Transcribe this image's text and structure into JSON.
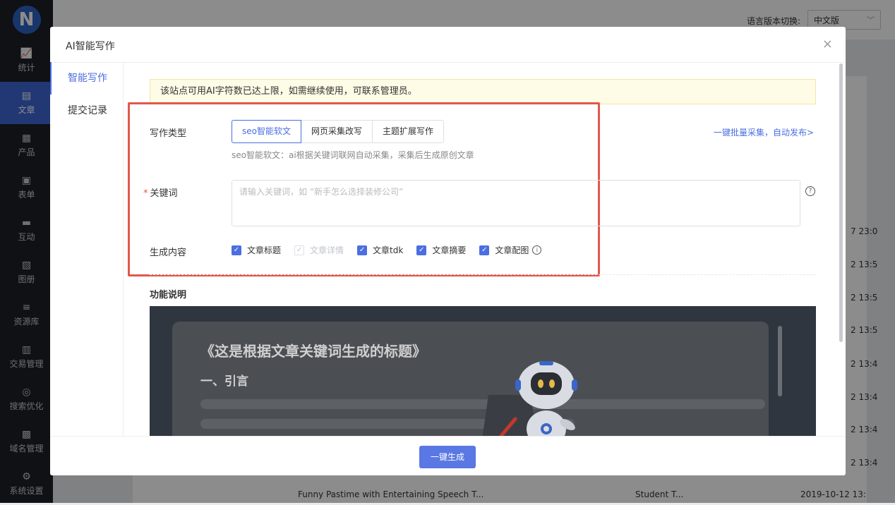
{
  "sidebar": {
    "logo": "N",
    "items": [
      {
        "label": "统计",
        "icon": "chart-icon",
        "glyph": "📈"
      },
      {
        "label": "文章",
        "icon": "article-icon",
        "glyph": "▤",
        "active": true
      },
      {
        "label": "产品",
        "icon": "product-icon",
        "glyph": "▦"
      },
      {
        "label": "表单",
        "icon": "form-icon",
        "glyph": "▣"
      },
      {
        "label": "互动",
        "icon": "chat-icon",
        "glyph": "▬"
      },
      {
        "label": "图册",
        "icon": "album-icon",
        "glyph": "▧"
      },
      {
        "label": "资源库",
        "icon": "database-icon",
        "glyph": "≡"
      },
      {
        "label": "交易管理",
        "icon": "bag-icon",
        "glyph": "▥"
      },
      {
        "label": "搜索优化",
        "icon": "target-icon",
        "glyph": "◎"
      },
      {
        "label": "域名管理",
        "icon": "domain-icon",
        "glyph": "▩"
      },
      {
        "label": "系统设置",
        "icon": "gear-icon",
        "glyph": "⚙"
      }
    ]
  },
  "topbar": {
    "lang_label": "语言版本切换:",
    "lang_value": "中文版"
  },
  "background": {
    "row_title": "Funny Pastime with Entertaining Speech T...",
    "row_tag": "Student T...",
    "row_date": "2019-10-12 13:",
    "dates": [
      "7 23:0",
      "2 13:5",
      "2 13:5",
      "2 13:5",
      "2 13:4",
      "2 13:4",
      "2 13:4",
      "2 13:4"
    ]
  },
  "modal": {
    "title": "AI智能写作",
    "close": "×",
    "tabs": [
      {
        "label": "智能写作",
        "active": true
      },
      {
        "label": "提交记录",
        "active": false
      }
    ],
    "notice": "该站点可用AI字符数已达上限，如需继续使用，可联系管理员。",
    "write_type": {
      "label": "写作类型",
      "options": [
        "seo智能软文",
        "网页采集改写",
        "主题扩展写作"
      ],
      "selected": "seo智能软文",
      "hint": "seo智能软文：ai根据关键词联网自动采集，采集后生成原创文章",
      "batch_link": "一键批量采集，自动发布>"
    },
    "keyword": {
      "required_mark": "*",
      "label": "关键词",
      "placeholder": "请输入关键词，如 “新手怎么选择装修公司”"
    },
    "generate_content": {
      "label": "生成内容",
      "options": [
        {
          "label": "文章标题",
          "checked": true,
          "disabled": false
        },
        {
          "label": "文章详情",
          "checked": true,
          "disabled": true
        },
        {
          "label": "文章tdk",
          "checked": true,
          "disabled": false
        },
        {
          "label": "文章摘要",
          "checked": true,
          "disabled": false
        },
        {
          "label": "文章配图",
          "checked": true,
          "disabled": false
        }
      ]
    },
    "feature_title": "功能说明",
    "illustration": {
      "heading": "《这是根据文章关键词生成的标题》",
      "subheading": "一、引言"
    },
    "generate_button": "一键生成"
  },
  "colors": {
    "accent": "#4b6ee0",
    "highlight_border": "#e2574c",
    "sidebar_bg": "#1c1f26"
  }
}
